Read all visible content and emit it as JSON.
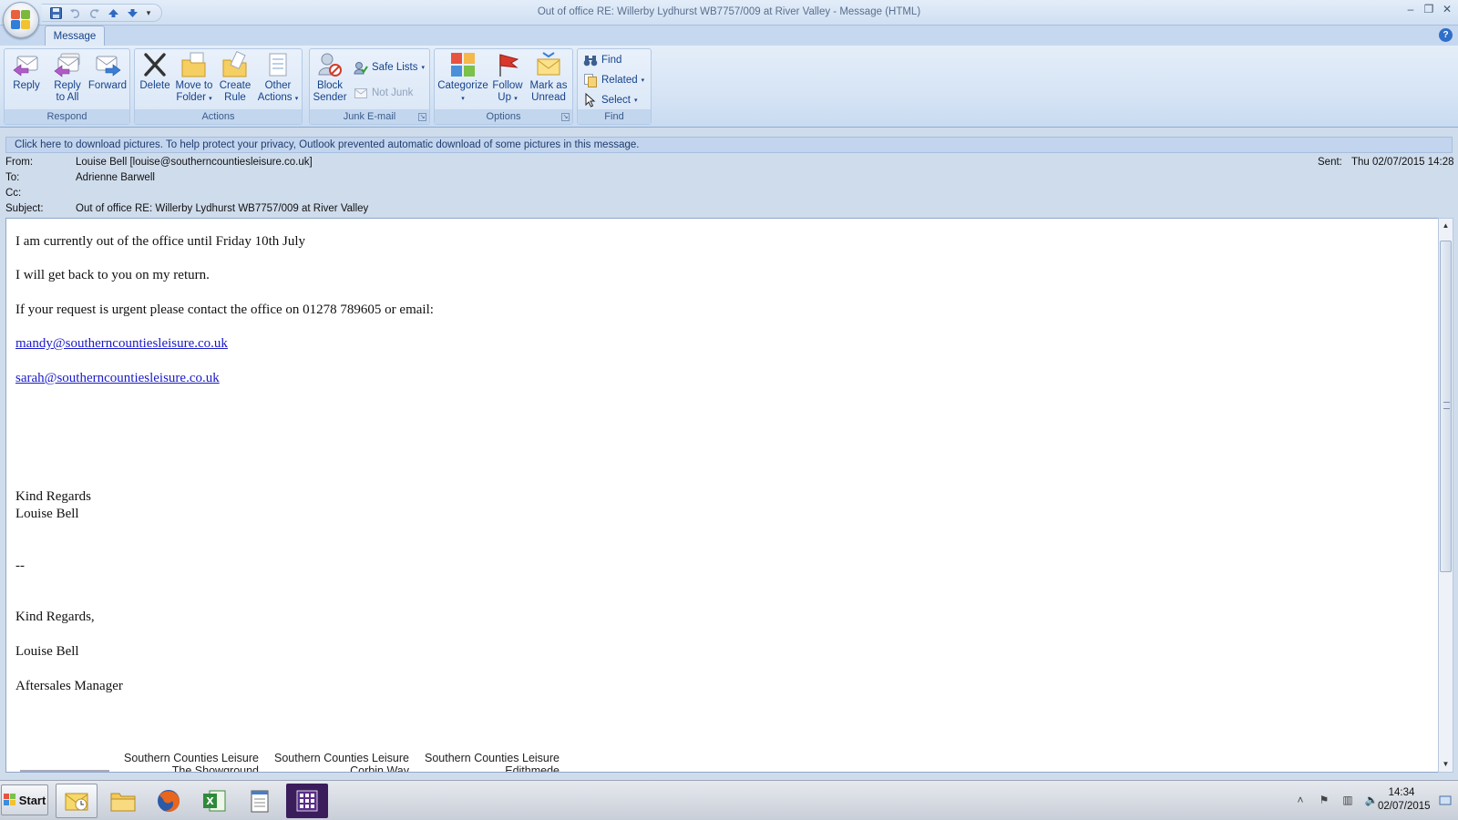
{
  "window": {
    "title": "Out of office RE: Willerby Lydhurst WB7757/009 at River Valley - Message (HTML)",
    "controls": {
      "minimize": "–",
      "restore": "❐",
      "close": "✕"
    }
  },
  "quick_access": {
    "icons": [
      "save-icon",
      "undo-icon",
      "redo-icon",
      "previous-item-icon",
      "next-item-icon",
      "customize-icon"
    ],
    "customize_glyph": "▾"
  },
  "tabs": {
    "message": "Message",
    "help_glyph": "?"
  },
  "ribbon": {
    "respond": {
      "label": "Respond",
      "reply": "Reply",
      "reply_all_1": "Reply",
      "reply_all_2": "to All",
      "forward": "Forward"
    },
    "actions": {
      "label": "Actions",
      "delete": "Delete",
      "move_1": "Move to",
      "move_2": "Folder",
      "create_1": "Create",
      "create_2": "Rule",
      "other_1": "Other",
      "other_2": "Actions"
    },
    "junk": {
      "label": "Junk E-mail",
      "block_1": "Block",
      "block_2": "Sender",
      "safe_lists": "Safe Lists",
      "not_junk": "Not Junk"
    },
    "options": {
      "label": "Options",
      "categorize": "Categorize",
      "follow_1": "Follow",
      "follow_2": "Up",
      "mark_1": "Mark as",
      "mark_2": "Unread"
    },
    "find": {
      "label": "Find",
      "find": "Find",
      "related": "Related",
      "select": "Select"
    },
    "dropdown_glyph": "▾",
    "launcher_glyph": "↘"
  },
  "infobar": {
    "text": "Click here to download pictures. To help protect your privacy, Outlook prevented automatic download of some pictures in this message."
  },
  "header": {
    "from_label": "From:",
    "from_value": "Louise Bell [louise@southerncountiesleisure.co.uk]",
    "to_label": "To:",
    "to_value": "Adrienne Barwell",
    "cc_label": "Cc:",
    "cc_value": "",
    "subject_label": "Subject:",
    "subject_value": "Out of office RE: Willerby Lydhurst WB7757/009 at River Valley",
    "sent_label": "Sent:",
    "sent_value": "Thu 02/07/2015 14:28"
  },
  "body": {
    "line1": "I am currently out of the office until Friday 10th July",
    "line2": "I will get back to you on my return.",
    "line3": "If your request is urgent please contact the office on 01278 789605 or email:",
    "email1": "mandy@southerncountiesleisure.co.uk",
    "email2": "sarah@southerncountiesleisure.co.uk",
    "regards1": "Kind Regards",
    "name1": "Louise Bell",
    "dashes": "--",
    "regards2": "Kind Regards,",
    "name2": "Louise Bell",
    "role": "Aftersales Manager",
    "sig_col1_title": "Southern Counties Leisure",
    "sig_col1_line2": "The Showground",
    "sig_col2_title": "Southern Counties Leisure",
    "sig_col2_line2": "Corbin Way",
    "sig_col3_title": "Southern Counties Leisure",
    "sig_col3_line2": "Edithmede"
  },
  "scrollbar": {
    "up_glyph": "▲",
    "down_glyph": "▼"
  },
  "taskbar": {
    "start_label": "Start",
    "apps": [
      "outlook-icon",
      "file-explorer-icon",
      "firefox-icon",
      "excel-icon",
      "notepad-icon",
      "calculator-app-icon"
    ],
    "tray": {
      "show_hidden": "˄",
      "flag": "⚑",
      "network": "▥",
      "volume": "🔈"
    },
    "time": "14:34",
    "date": "02/07/2015"
  }
}
